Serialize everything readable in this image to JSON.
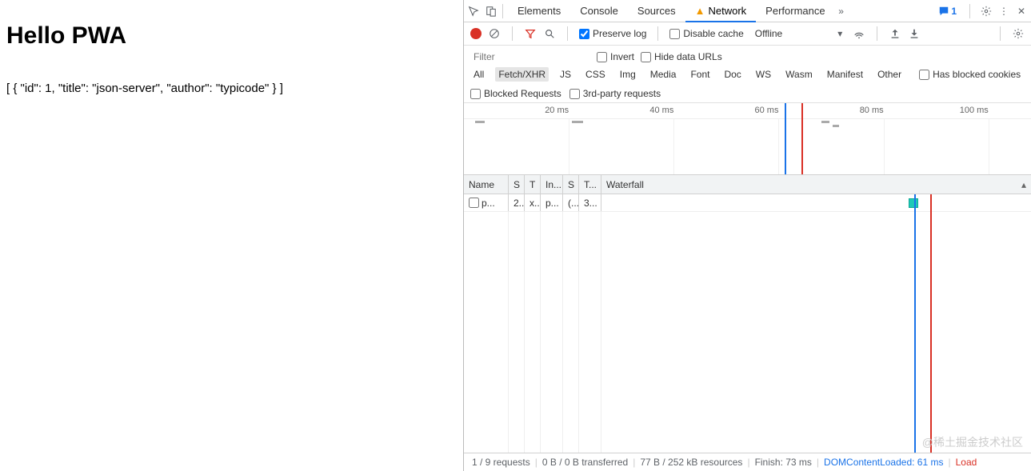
{
  "page": {
    "title": "Hello PWA",
    "body_text": "[ { \"id\": 1, \"title\": \"json-server\", \"author\": \"typicode\" } ]"
  },
  "tabs": {
    "elements": "Elements",
    "console": "Console",
    "sources": "Sources",
    "network": "Network",
    "performance": "Performance",
    "chat_count": "1"
  },
  "toolbar": {
    "preserve_log": "Preserve log",
    "disable_cache": "Disable cache",
    "throttling": "Offline"
  },
  "filterbar": {
    "filter_placeholder": "Filter",
    "invert": "Invert",
    "hide_data_urls": "Hide data URLs"
  },
  "chips": {
    "all": "All",
    "fetch_xhr": "Fetch/XHR",
    "js": "JS",
    "css": "CSS",
    "img": "Img",
    "media": "Media",
    "font": "Font",
    "doc": "Doc",
    "ws": "WS",
    "wasm": "Wasm",
    "manifest": "Manifest",
    "other": "Other",
    "has_blocked_cookies": "Has blocked cookies",
    "blocked_requests": "Blocked Requests",
    "third_party": "3rd-party requests"
  },
  "timeline": {
    "ticks": [
      "20 ms",
      "40 ms",
      "60 ms",
      "80 ms",
      "100 ms"
    ]
  },
  "table": {
    "headers": {
      "name": "Name",
      "s": "S",
      "t": "T",
      "ini": "In...",
      "sz": "S",
      "ti": "T...",
      "wf": "Waterfall"
    },
    "rows": [
      {
        "name": "p...",
        "s": "2...",
        "t": "x...",
        "ini": "p...",
        "sz": "(...",
        "ti": "3..."
      }
    ]
  },
  "status": {
    "requests": "1 / 9 requests",
    "transferred": "0 B / 0 B transferred",
    "resources": "77 B / 252 kB resources",
    "finish": "Finish: 73 ms",
    "dcl": "DOMContentLoaded: 61 ms",
    "load": "Load"
  },
  "watermark": "@稀土掘金技术社区"
}
